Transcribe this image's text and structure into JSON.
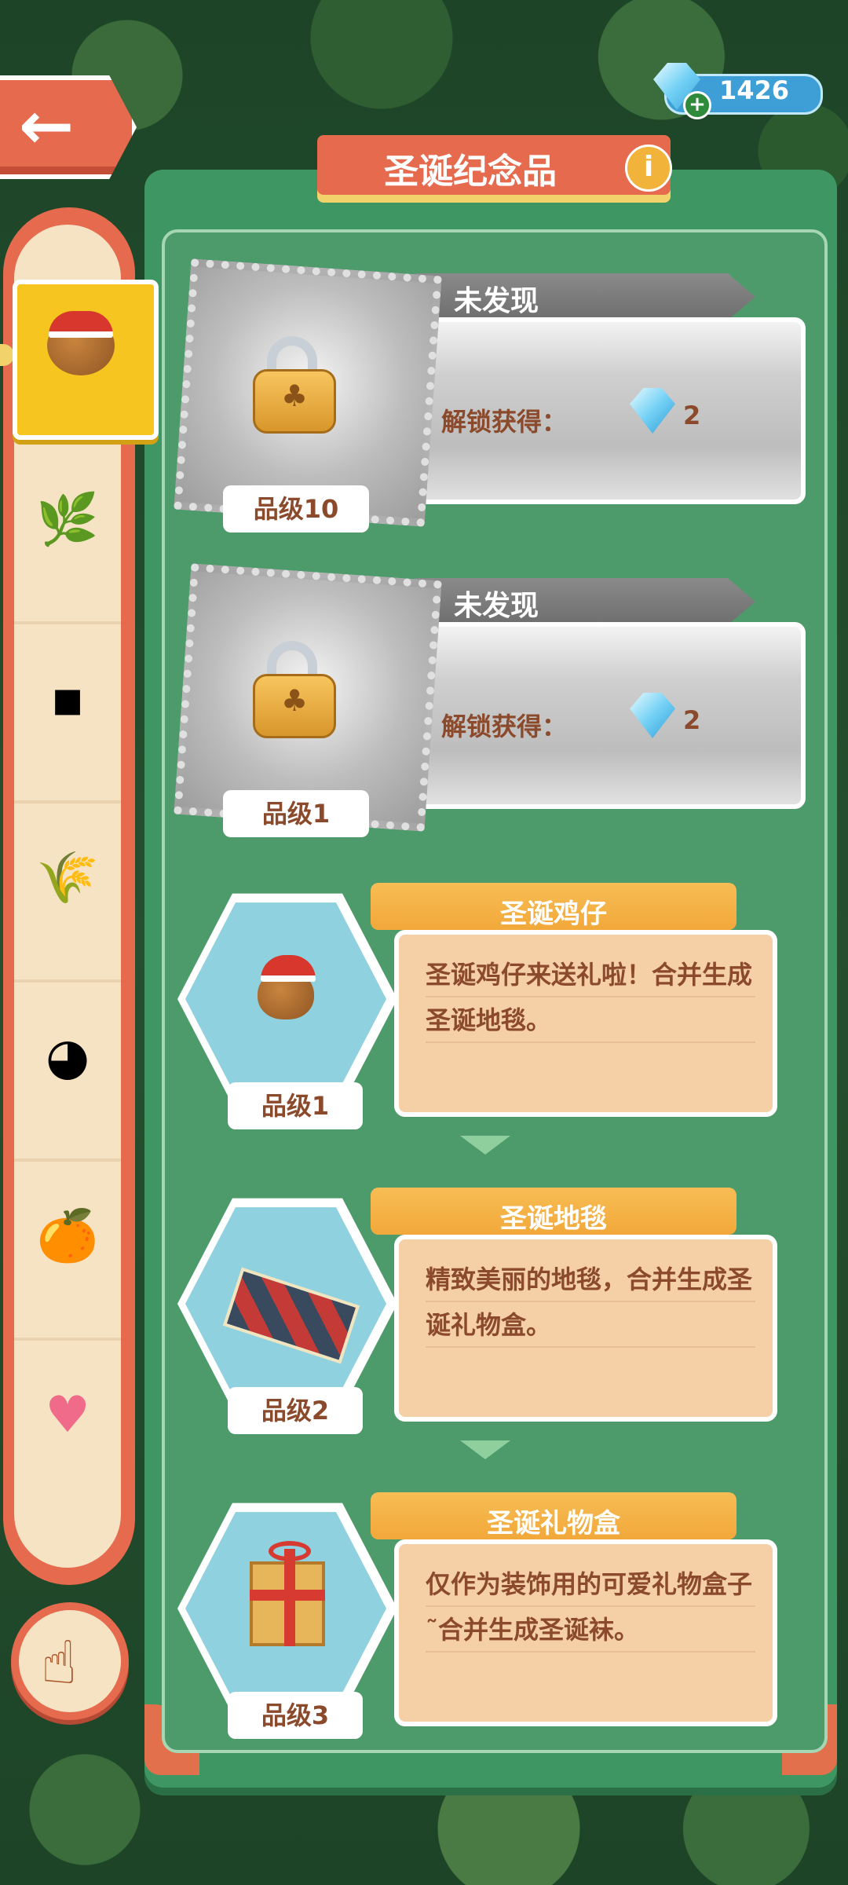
{
  "header": {
    "title": "圣诞纪念品",
    "gem_count": "1426",
    "icons": {
      "back": "back-arrow-icon",
      "info": "info-icon",
      "gem": "gem-icon",
      "plus": "plus-icon"
    }
  },
  "sidebar": {
    "items": [
      {
        "icon": "christmas-chick-icon",
        "selected": true
      },
      {
        "icon": "cotton-branch-icon",
        "selected": false
      },
      {
        "icon": "sugar-cube-icon",
        "selected": false
      },
      {
        "icon": "wheat-plant-icon",
        "selected": false
      },
      {
        "icon": "dumpling-icon",
        "selected": false
      },
      {
        "icon": "orange-tree-icon",
        "selected": false
      },
      {
        "icon": "heart-icon",
        "selected": false
      }
    ],
    "bottom_button_icon": "pointing-hand-icon"
  },
  "locked": [
    {
      "status": "未发现",
      "unlock_label": "解锁获得：",
      "reward": "2",
      "grade": "品级10"
    },
    {
      "status": "未发现",
      "unlock_label": "解锁获得：",
      "reward": "2",
      "grade": "品级1"
    }
  ],
  "items": [
    {
      "name": "圣诞鸡仔",
      "desc": "圣诞鸡仔来送礼啦！合并生成圣诞地毯。",
      "grade": "品级1"
    },
    {
      "name": "圣诞地毯",
      "desc": "精致美丽的地毯，合并生成圣诞礼物盒。",
      "grade": "品级2"
    },
    {
      "name": "圣诞礼物盒",
      "desc": "仅作为装饰用的可爱礼物盒子˜合并生成圣诞袜。",
      "grade": "品级3"
    }
  ]
}
